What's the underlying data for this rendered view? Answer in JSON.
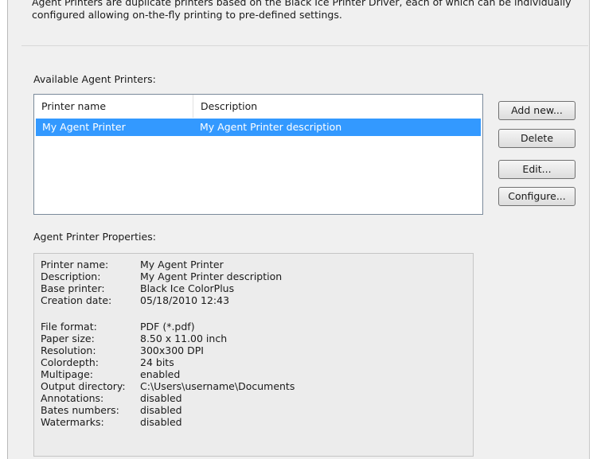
{
  "intro": {
    "text": "Agent Printers are duplicate printers based on the Black Ice Printer Driver, each of which can be individually configured allowing on-the-fly printing to pre-defined settings."
  },
  "available": {
    "label": "Available Agent Printers:",
    "columns": [
      "Printer name",
      "Description"
    ],
    "rows": [
      {
        "name": "My Agent Printer",
        "description": "My Agent Printer description",
        "selected": true
      }
    ],
    "selection_color": "#3399ff"
  },
  "buttons": {
    "add_new": "Add new...",
    "delete": "Delete",
    "edit": "Edit...",
    "configure": "Configure..."
  },
  "properties": {
    "label": "Agent Printer Properties:",
    "group1": [
      {
        "key": "Printer name:",
        "value": "My Agent Printer"
      },
      {
        "key": "Description:",
        "value": "My Agent Printer description"
      },
      {
        "key": "Base printer:",
        "value": "Black Ice ColorPlus"
      },
      {
        "key": "Creation date:",
        "value": "05/18/2010 12:43"
      }
    ],
    "group2": [
      {
        "key": "File format:",
        "value": "PDF (*.pdf)"
      },
      {
        "key": "Paper size:",
        "value": "8.50 x 11.00 inch"
      },
      {
        "key": "Resolution:",
        "value": "300x300 DPI"
      },
      {
        "key": "Colordepth:",
        "value": "24 bits"
      },
      {
        "key": "Multipage:",
        "value": "enabled"
      },
      {
        "key": "Output directory:",
        "value": "C:\\Users\\username\\Documents"
      },
      {
        "key": "Annotations:",
        "value": "disabled"
      },
      {
        "key": "Bates numbers:",
        "value": "disabled"
      },
      {
        "key": "Watermarks:",
        "value": "disabled"
      }
    ]
  }
}
